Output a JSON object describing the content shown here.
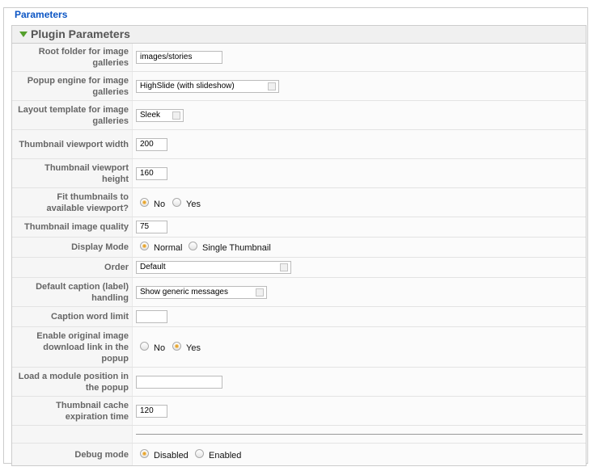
{
  "legend": "Parameters",
  "panel_title": "Plugin Parameters",
  "rows": {
    "root_folder": {
      "label": "Root folder for image galleries",
      "value": "images/stories"
    },
    "popup_engine": {
      "label": "Popup engine for image galleries",
      "value": "HighSlide (with slideshow)"
    },
    "layout_template": {
      "label": "Layout template for image galleries",
      "value": "Sleek"
    },
    "thumb_width": {
      "label": "Thumbnail viewport width",
      "value": "200"
    },
    "thumb_height": {
      "label": "Thumbnail viewport height",
      "value": "160"
    },
    "fit_thumbs": {
      "label": "Fit thumbnails to available viewport?",
      "opt1": "No",
      "opt2": "Yes",
      "selected": "No"
    },
    "thumb_quality": {
      "label": "Thumbnail image quality",
      "value": "75"
    },
    "display_mode": {
      "label": "Display Mode",
      "opt1": "Normal",
      "opt2": "Single Thumbnail",
      "selected": "Normal"
    },
    "order": {
      "label": "Order",
      "value": "Default"
    },
    "default_caption": {
      "label": "Default caption (label) handling",
      "value": "Show generic messages"
    },
    "caption_limit": {
      "label": "Caption word limit",
      "value": ""
    },
    "download_link": {
      "label": "Enable original image download link in the popup",
      "opt1": "No",
      "opt2": "Yes",
      "selected": "Yes"
    },
    "module_position": {
      "label": "Load a module position in the popup",
      "value": ""
    },
    "cache_expiration": {
      "label": "Thumbnail cache expiration time",
      "value": "120"
    },
    "debug_mode": {
      "label": "Debug mode",
      "opt1": "Disabled",
      "opt2": "Enabled",
      "selected": "Disabled"
    }
  },
  "colors": {
    "legend": "#0b55c4",
    "radio_selected": "#e3a330",
    "expand_arrow": "#54a02c"
  }
}
